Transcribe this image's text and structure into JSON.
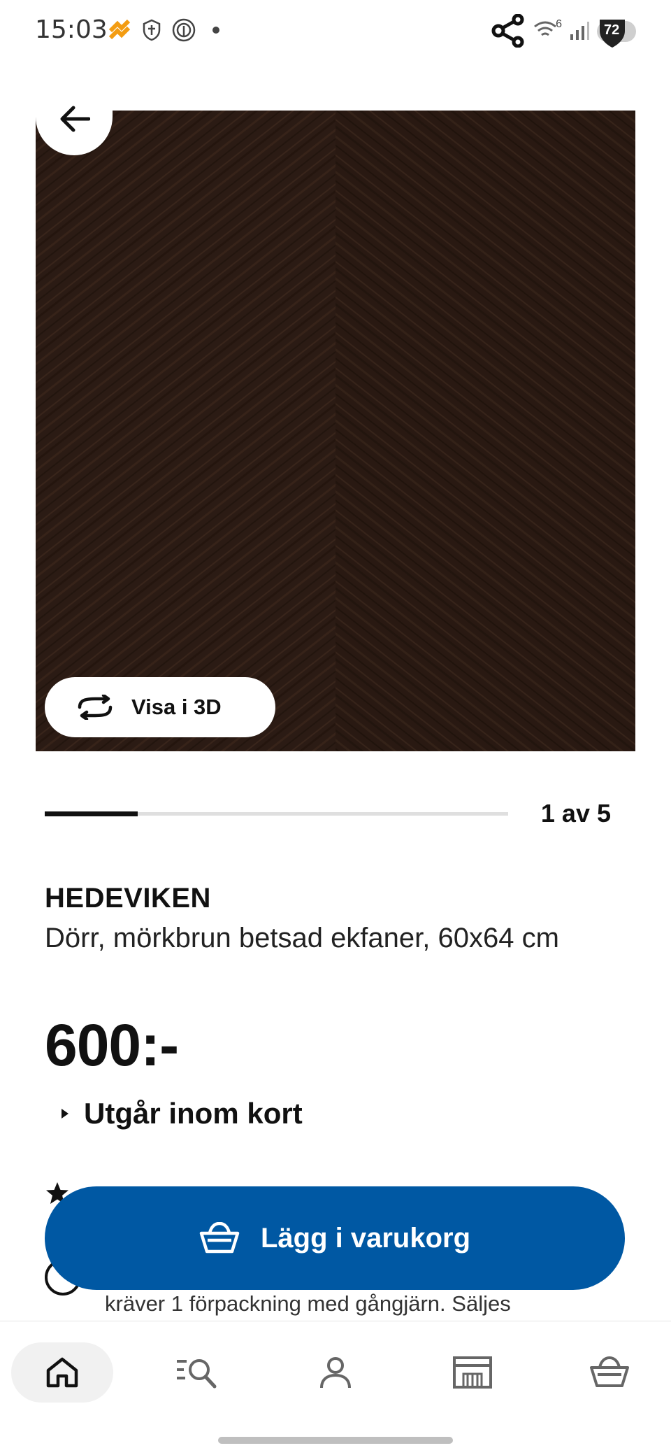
{
  "status_bar": {
    "time": "15:03",
    "battery": "72",
    "signal_badge": "6"
  },
  "image_viewer": {
    "view3d_label": "Visa i 3D",
    "counter": "1 av 5",
    "progress": 0.2
  },
  "product": {
    "name": "HEDEVIKEN",
    "description": "Dörr, mörkbrun betsad ekfaner, 60x64 cm",
    "price": "600:-",
    "stock_status": "Utgår inom kort"
  },
  "info": {
    "partial_text": "kräver 1 förpackning med gångjärn. Säljes"
  },
  "cart_button": {
    "label": "Lägg i varukorg",
    "color": "#0058a3"
  },
  "bottom_nav": {
    "items": [
      {
        "icon": "home-icon",
        "active": true
      },
      {
        "icon": "search-list-icon",
        "active": false
      },
      {
        "icon": "profile-icon",
        "active": false
      },
      {
        "icon": "store-icon",
        "active": false
      },
      {
        "icon": "cart-icon",
        "active": false
      }
    ]
  }
}
